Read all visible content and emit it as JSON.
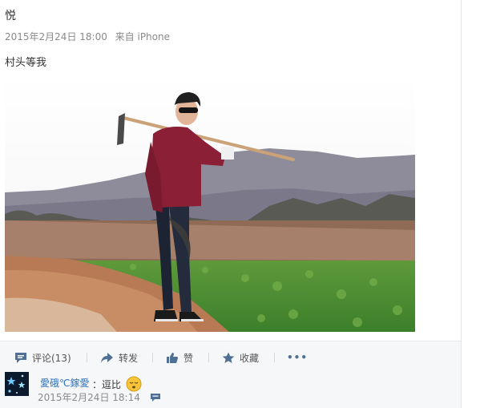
{
  "post": {
    "author": "悦",
    "date": "2015年2月24日 18:00",
    "source": "来自 iPhone",
    "text": "村头等我"
  },
  "toolbar": {
    "comment_label": "评论(13)",
    "repost_label": "转发",
    "like_label": "赞",
    "favorite_label": "收藏",
    "more_label": "•••"
  },
  "comment": {
    "user": "愛硪℃鎵愛",
    "text": "：逗比",
    "time": "2015年2月24日 18:14"
  },
  "colors": {
    "link": "#2a6ebb",
    "toolbar_bg": "#f6f7f9",
    "meta_gray": "#8a8a8a",
    "icon_blue": "#4f6f95"
  }
}
